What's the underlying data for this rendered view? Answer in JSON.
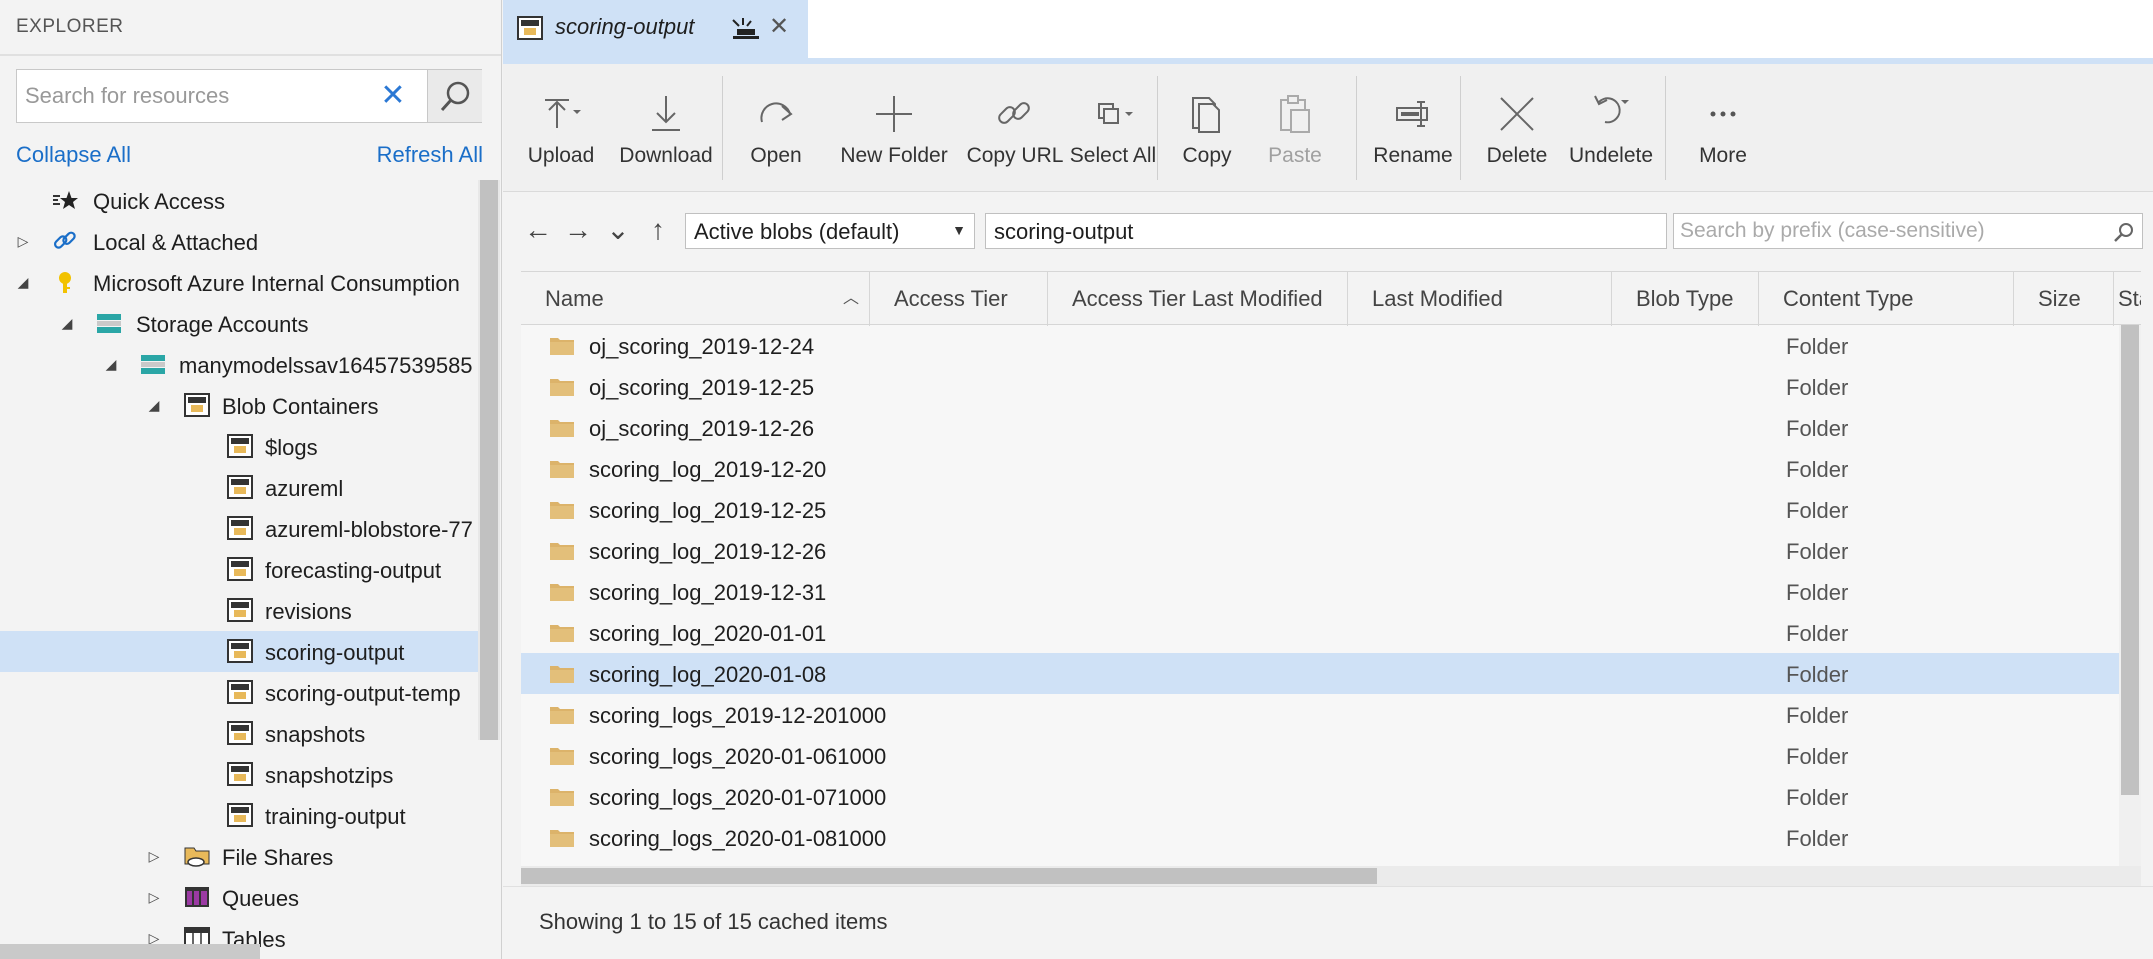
{
  "explorer": {
    "title": "EXPLORER",
    "search_placeholder": "Search for resources",
    "collapse_all": "Collapse All",
    "refresh_all": "Refresh All",
    "tree": [
      {
        "label": "Quick Access",
        "icon": "quick-access-icon"
      },
      {
        "label": "Local & Attached",
        "icon": "link-icon"
      },
      {
        "label": "Microsoft Azure Internal Consumption",
        "icon": "key-icon"
      },
      {
        "label": "Storage Accounts",
        "icon": "storage-accounts-icon"
      },
      {
        "label": "manymodelssav16457539585",
        "icon": "storage-account-icon"
      },
      {
        "label": "Blob Containers",
        "icon": "blob-containers-icon"
      },
      {
        "label": "$logs",
        "icon": "container-icon"
      },
      {
        "label": "azureml",
        "icon": "container-icon"
      },
      {
        "label": "azureml-blobstore-77",
        "icon": "container-icon"
      },
      {
        "label": "forecasting-output",
        "icon": "container-icon"
      },
      {
        "label": "revisions",
        "icon": "container-icon"
      },
      {
        "label": "scoring-output",
        "icon": "container-icon",
        "selected": true
      },
      {
        "label": "scoring-output-temp",
        "icon": "container-icon"
      },
      {
        "label": "snapshots",
        "icon": "container-icon"
      },
      {
        "label": "snapshotzips",
        "icon": "container-icon"
      },
      {
        "label": "training-output",
        "icon": "container-icon"
      },
      {
        "label": "File Shares",
        "icon": "file-shares-icon"
      },
      {
        "label": "Queues",
        "icon": "queues-icon"
      },
      {
        "label": "Tables",
        "icon": "tables-icon"
      }
    ]
  },
  "tab": {
    "label": "scoring-output"
  },
  "toolbar": {
    "upload": "Upload",
    "download": "Download",
    "open": "Open",
    "new_folder": "New Folder",
    "copy_url": "Copy URL",
    "select_all": "Select All",
    "copy": "Copy",
    "paste": "Paste",
    "rename": "Rename",
    "delete": "Delete",
    "undelete": "Undelete",
    "more": "More"
  },
  "address": {
    "blob_filter": "Active blobs (default)",
    "path": "scoring-output",
    "prefix_placeholder": "Search by prefix (case-sensitive)"
  },
  "table": {
    "columns": [
      "Name",
      "Access Tier",
      "Access Tier Last Modified",
      "Last Modified",
      "Blob Type",
      "Content Type",
      "Size",
      "Sta"
    ],
    "rows": [
      {
        "name": "oj_scoring_2019-12-24",
        "content_type": "Folder"
      },
      {
        "name": "oj_scoring_2019-12-25",
        "content_type": "Folder"
      },
      {
        "name": "oj_scoring_2019-12-26",
        "content_type": "Folder"
      },
      {
        "name": "scoring_log_2019-12-20",
        "content_type": "Folder"
      },
      {
        "name": "scoring_log_2019-12-25",
        "content_type": "Folder"
      },
      {
        "name": "scoring_log_2019-12-26",
        "content_type": "Folder"
      },
      {
        "name": "scoring_log_2019-12-31",
        "content_type": "Folder"
      },
      {
        "name": "scoring_log_2020-01-01",
        "content_type": "Folder"
      },
      {
        "name": "scoring_log_2020-01-08",
        "content_type": "Folder",
        "selected": true
      },
      {
        "name": "scoring_logs_2019-12-201000",
        "content_type": "Folder"
      },
      {
        "name": "scoring_logs_2020-01-061000",
        "content_type": "Folder"
      },
      {
        "name": "scoring_logs_2020-01-071000",
        "content_type": "Folder"
      },
      {
        "name": "scoring_logs_2020-01-081000",
        "content_type": "Folder"
      }
    ]
  },
  "status": {
    "text": "Showing 1 to 15 of 15 cached items"
  },
  "colors": {
    "accent": "#cfe1f6",
    "link": "#1a6ec8",
    "folder": "#dcb36a"
  }
}
